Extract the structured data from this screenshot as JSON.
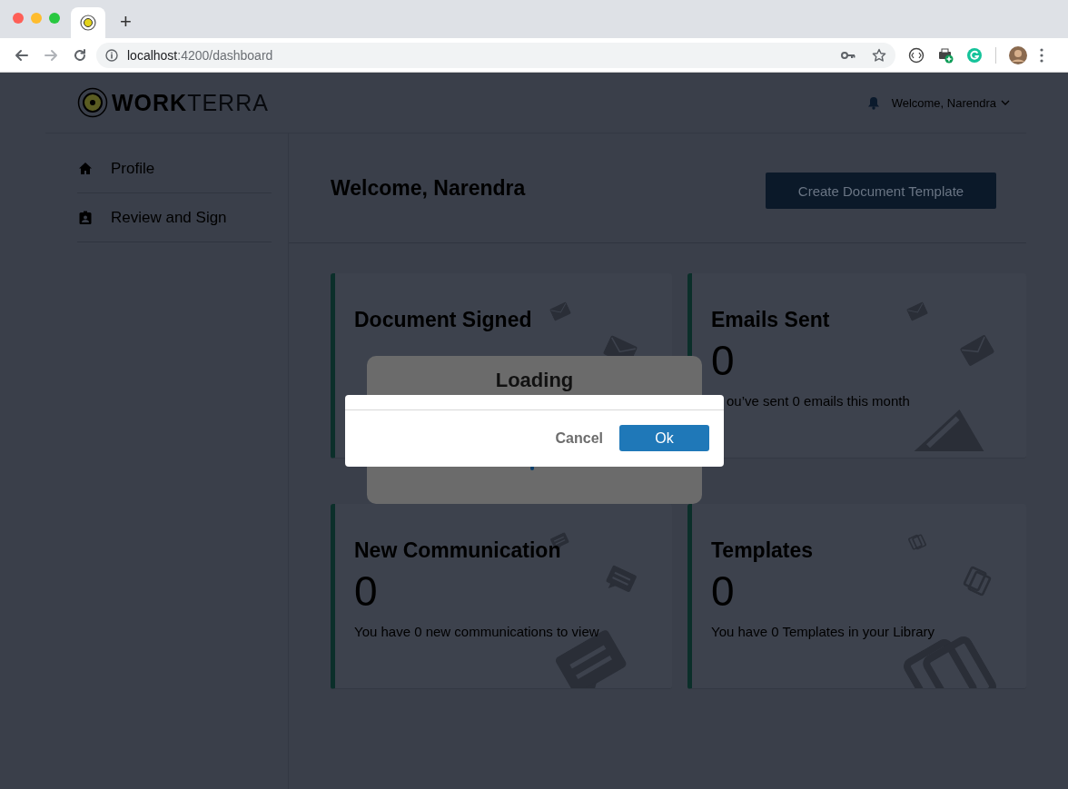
{
  "browser": {
    "new_tab": "+",
    "address": {
      "host": "localhost",
      "path": ":4200/dashboard"
    }
  },
  "app": {
    "brand": {
      "strong": "WORK",
      "light": "TERRA"
    },
    "user_menu": "Welcome, Narendra"
  },
  "sidebar": {
    "items": [
      {
        "kind": "home",
        "label": "Profile"
      },
      {
        "kind": "badge",
        "label": "Review and Sign"
      }
    ]
  },
  "main": {
    "title": "Welcome, Narendra",
    "action": "Create Document Template",
    "cards": [
      {
        "kind": "signed",
        "title": "Document Signed"
      },
      {
        "kind": "email",
        "title": "Emails Sent",
        "count": "0",
        "caption": "ou’ve sent 0 emails this month"
      },
      {
        "kind": "chat",
        "title": "New Communication",
        "count": "0",
        "caption": "You have 0 new communications to view"
      },
      {
        "kind": "template",
        "title": "Templates",
        "count": "0",
        "caption": "You have 0 Templates in your Library"
      }
    ]
  },
  "loading": {
    "title": "Loading"
  },
  "dialog": {
    "buttons": [
      {
        "kind": "secondary",
        "label": "Cancel"
      },
      {
        "kind": "primary",
        "label": "Ok"
      }
    ]
  }
}
